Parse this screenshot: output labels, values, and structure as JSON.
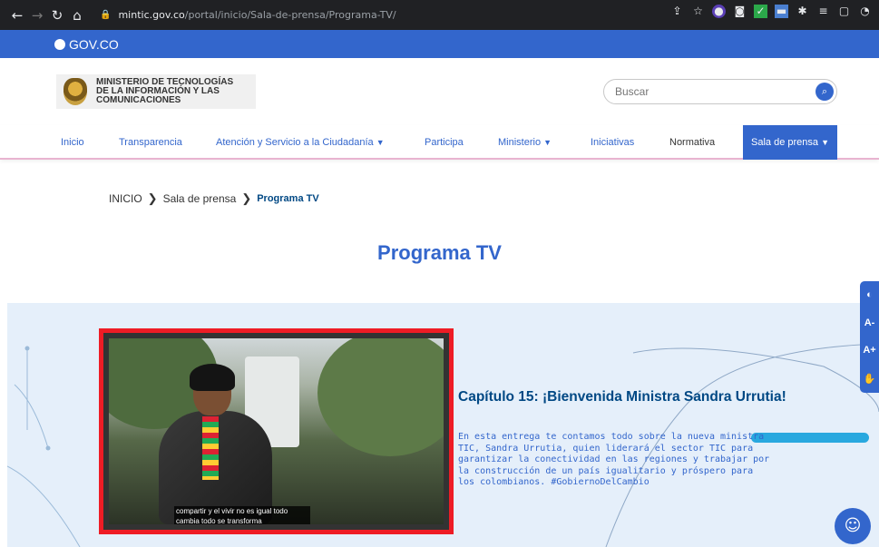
{
  "browser": {
    "url_host": "mintic.gov.co",
    "url_path": "/portal/inicio/Sala-de-prensa/Programa-TV/"
  },
  "govbar": {
    "label": "GOV.CO"
  },
  "ministry": {
    "line1": "MINISTERIO DE TECNOLOGÍAS",
    "line2": "DE LA INFORMACIÓN Y LAS",
    "line3": "COMUNICACIONES"
  },
  "search": {
    "placeholder": "Buscar"
  },
  "nav": {
    "items": [
      "Inicio",
      "Transparencia",
      "Atención y Servicio a la Ciudadanía",
      "Participa",
      "Ministerio",
      "Iniciativas",
      "Normativa",
      "Sala de prensa"
    ]
  },
  "breadcrumb": {
    "home": "INICIO",
    "section": "Sala de prensa",
    "current": "Programa TV"
  },
  "page": {
    "title": "Programa TV"
  },
  "feature": {
    "title": "Capítulo 15: ¡Bienvenida Ministra Sandra Urrutia!",
    "description": "En esta entrega te contamos todo sobre la nueva ministra TIC, Sandra Urrutia, quien liderará el sector TIC para garantizar la conectividad en las regiones y trabajar por la construcción de un país igualitario y próspero para los colombianos. #GobiernoDelCambio",
    "caption_line1": "compartir y el vivir no es igual todo",
    "caption_line2": "cambia todo se transforma"
  },
  "accessibility": {
    "contrast": "◐",
    "font_smaller": "A-",
    "font_bigger": "A+",
    "sign": "✋"
  },
  "colors": {
    "brand": "#3366cc",
    "dark_blue": "#004884",
    "highlight": "#ee1c25"
  }
}
